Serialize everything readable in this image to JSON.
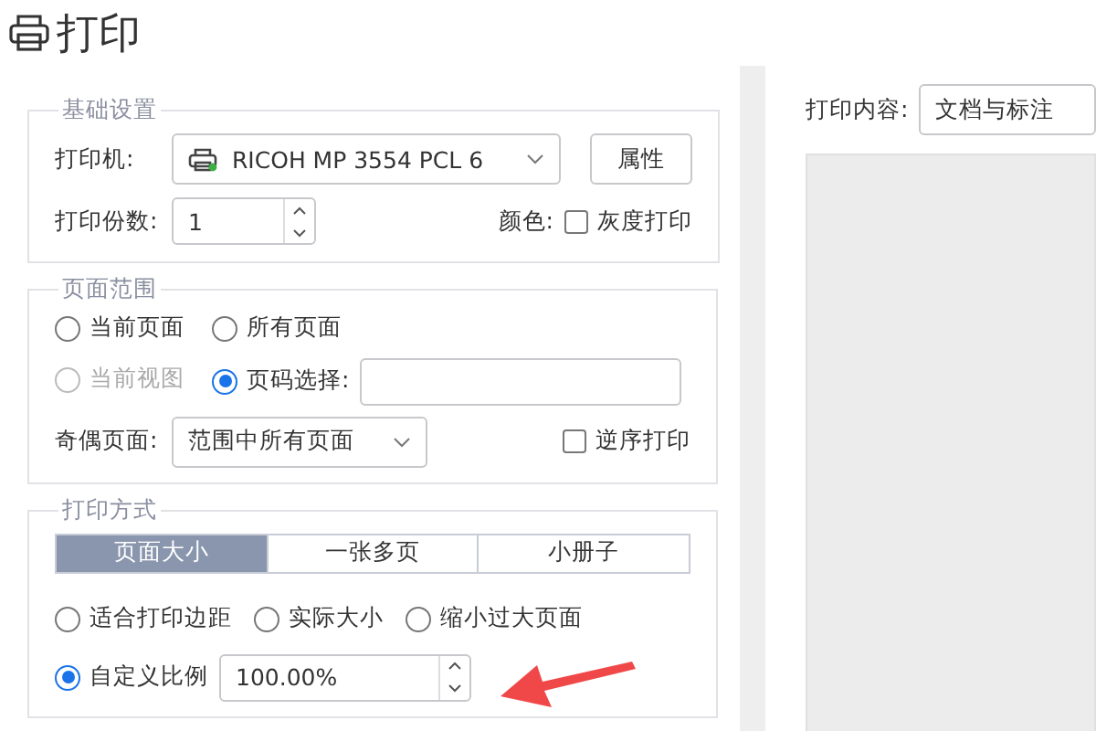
{
  "window": {
    "title": "打印"
  },
  "basic": {
    "legend": "基础设置",
    "printer_label": "打印机:",
    "printer": "RICOH MP 3554 PCL 6",
    "properties_button": "属性",
    "copies_label": "打印份数:",
    "copies": "1",
    "color_label": "颜色:",
    "grayscale": {
      "label": "灰度打印",
      "checked": false
    }
  },
  "page_range": {
    "legend": "页面范围",
    "options": [
      {
        "label": "当前页面",
        "kind": "radio",
        "selected": false,
        "disabled": false
      },
      {
        "label": "所有页面",
        "kind": "radio",
        "selected": false,
        "disabled": false
      },
      {
        "label": "当前视图",
        "kind": "radio",
        "selected": false,
        "disabled": true
      },
      {
        "label": "页码选择:",
        "kind": "radio_field",
        "selected": true,
        "disabled": false
      }
    ],
    "odd_even_label": "奇偶页面:",
    "odd_even": "范围中所有页面",
    "reverse": {
      "label": "逆序打印",
      "checked": false
    }
  },
  "print_mode": {
    "legend": "打印方式",
    "tabs": [
      {
        "label": "页面大小",
        "selected": true
      },
      {
        "label": "一张多页",
        "selected": false
      },
      {
        "label": "小册子",
        "selected": false
      }
    ],
    "scaling_options": [
      {
        "label": "适合打印边距",
        "kind": "radio",
        "selected": false
      },
      {
        "label": "实际大小",
        "kind": "radio",
        "selected": false
      },
      {
        "label": "缩小过大页面",
        "kind": "radio",
        "selected": false
      },
      {
        "label": "自定义比例",
        "kind": "radio_field",
        "selected": true,
        "value": "100.00%"
      }
    ]
  },
  "print_content": {
    "label": "打印内容:",
    "value": "文档与标注"
  }
}
